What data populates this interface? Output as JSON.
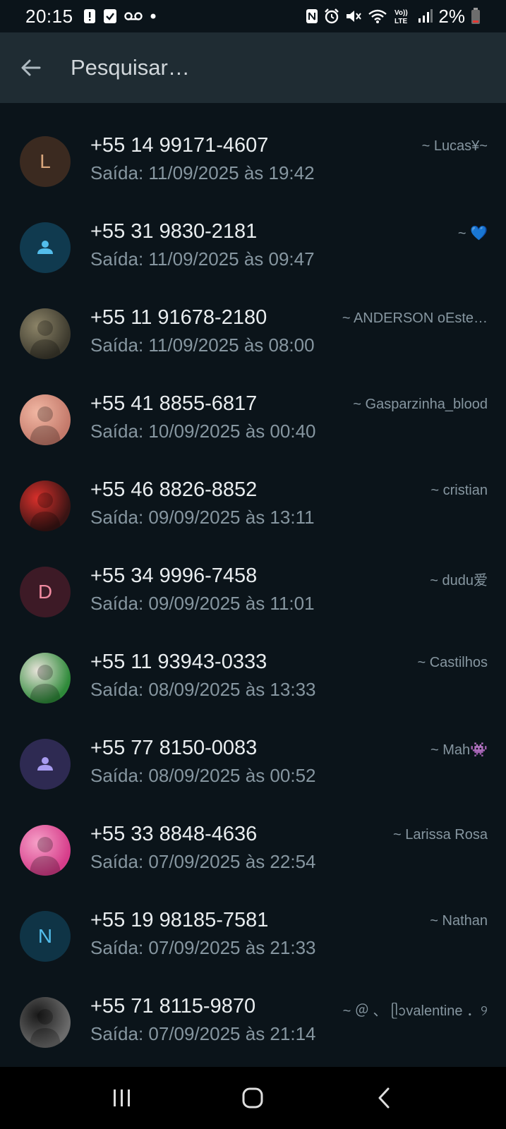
{
  "status_bar": {
    "time": "20:15",
    "battery": "2%",
    "left_icons": [
      "alert-icon",
      "check-box-icon",
      "voicemail-icon",
      "dot-icon"
    ],
    "right_icons": [
      "nfc-icon",
      "alarm-icon",
      "mute-icon",
      "wifi-icon",
      "volte-icon",
      "signal-icon",
      "battery-icon"
    ]
  },
  "search": {
    "placeholder": "Pesquisar…",
    "value": ""
  },
  "participants": [
    {
      "phone": "+55 14 99171-4607",
      "exit": "Saída: 11/09/2025 às 19:42",
      "name": "~ Lucas¥~",
      "avatar_letter": "L",
      "avatar_type": "letter",
      "avatar_bg": "#3b2a20",
      "avatar_fg": "#d9a77c"
    },
    {
      "phone": "+55 31 9830-2181",
      "exit": "Saída: 11/09/2025 às 09:47",
      "name": "~ 💙",
      "avatar_letter": "",
      "avatar_type": "person",
      "avatar_bg": "#103a4f",
      "avatar_fg": "#53bdeb"
    },
    {
      "phone": "+55 11 91678-2180",
      "exit": "Saída: 11/09/2025 às 08:00",
      "name": "~ ANDERSON  oEste…",
      "avatar_letter": "",
      "avatar_type": "photo",
      "avatar_bg": "#3d3a2e",
      "avatar_fg": "#8c8468"
    },
    {
      "phone": "+55 41 8855-6817",
      "exit": "Saída: 10/09/2025 às 00:40",
      "name": "~ Gasparzinha_blood",
      "avatar_letter": "",
      "avatar_type": "photo",
      "avatar_bg": "#c47a6b",
      "avatar_fg": "#f1b7a3"
    },
    {
      "phone": "+55 46 8826-8852",
      "exit": "Saída: 09/09/2025 às 13:11",
      "name": "~ cristian",
      "avatar_letter": "",
      "avatar_type": "photo",
      "avatar_bg": "#3a1414",
      "avatar_fg": "#d9302b"
    },
    {
      "phone": "+55 34 9996-7458",
      "exit": "Saída: 09/09/2025 às 11:01",
      "name": "~ dudu爱",
      "avatar_letter": "D",
      "avatar_type": "letter",
      "avatar_bg": "#3d1a26",
      "avatar_fg": "#f08aa0"
    },
    {
      "phone": "+55 11 93943-0333",
      "exit": "Saída: 08/09/2025 às 13:33",
      "name": "~ Castilhos",
      "avatar_letter": "",
      "avatar_type": "photo",
      "avatar_bg": "#2f8a3a",
      "avatar_fg": "#e8e3da"
    },
    {
      "phone": "+55 77 8150-0083",
      "exit": "Saída: 08/09/2025 às 00:52",
      "name": "~ Mah👾",
      "avatar_letter": "",
      "avatar_type": "person",
      "avatar_bg": "#2e2a52",
      "avatar_fg": "#a89cf0"
    },
    {
      "phone": "+55 33 8848-4636",
      "exit": "Saída: 07/09/2025 às 22:54",
      "name": "~ Larissa Rosa",
      "avatar_letter": "",
      "avatar_type": "photo",
      "avatar_bg": "#d63d8a",
      "avatar_fg": "#f6a0c8"
    },
    {
      "phone": "+55 19 98185-7581",
      "exit": "Saída: 07/09/2025 às 21:33",
      "name": "~ Nathan",
      "avatar_letter": "N",
      "avatar_type": "letter",
      "avatar_bg": "#0f3446",
      "avatar_fg": "#53bdeb"
    },
    {
      "phone": "+55 71 8115-9870",
      "exit": "Saída: 07/09/2025 às 21:14",
      "name": "~ ＠ 、 ᥫᩣvalentine ．୨",
      "avatar_letter": "",
      "avatar_type": "photo",
      "avatar_bg": "#6b6b6b",
      "avatar_fg": "#1a1a1a"
    }
  ],
  "nav": {
    "icons": [
      "recents-icon",
      "home-icon",
      "back-nav-icon"
    ]
  },
  "colors": {
    "background": "#0b141a",
    "header": "#1f2c33",
    "primary_text": "#e9edef",
    "secondary_text": "#8696a0"
  }
}
